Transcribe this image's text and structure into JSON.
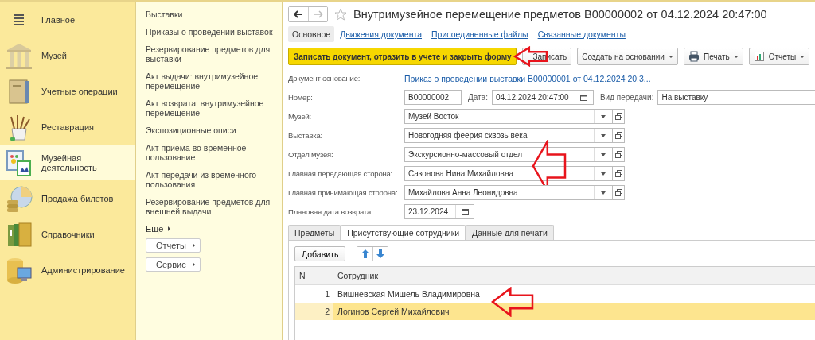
{
  "sections": [
    {
      "label": "Главное",
      "selected": false
    },
    {
      "label": "Музей",
      "selected": false
    },
    {
      "label": "Учетные операции",
      "selected": false
    },
    {
      "label": "Реставрация",
      "selected": false
    },
    {
      "label": "Музейная деятельность",
      "selected": true
    },
    {
      "label": "Продажа билетов",
      "selected": false
    },
    {
      "label": "Справочники",
      "selected": false
    },
    {
      "label": "Администрирование",
      "selected": false
    }
  ],
  "section_menu": {
    "items": [
      "Выставки",
      "Приказы о проведении выставок",
      "Резервирование предметов для выставки",
      "Акт выдачи: внутримузейное перемещение",
      "Акт возврата: внутримузейное перемещение",
      "Экспозиционные описи",
      "Акт приема во временное пользование",
      "Акт передачи из временного пользования",
      "Резервирование предметов для внешней выдачи"
    ],
    "more": "Еще",
    "buttons": [
      "Отчеты",
      "Сервис"
    ]
  },
  "document": {
    "title": "Внутримузейное перемещение предметов В00000002 от 04.12.2024 20:47:00",
    "tabs": [
      {
        "label": "Основное",
        "selected": true
      },
      {
        "label": "Движения документа",
        "selected": false
      },
      {
        "label": "Присоединенные файлы",
        "selected": false
      },
      {
        "label": "Связанные документы",
        "selected": false
      }
    ],
    "toolbar": [
      {
        "kind": "primary",
        "label": "Записать документ, отразить в учете и закрыть форму",
        "marked": true
      },
      {
        "kind": "plain",
        "label": "Записать",
        "marked": false
      },
      {
        "kind": "menu",
        "label": "Создать на основании",
        "marked": false
      },
      {
        "kind": "print",
        "label": "Печать",
        "marked": false
      },
      {
        "kind": "report",
        "label": "Отчеты",
        "marked": false
      }
    ],
    "basis": {
      "label": "Документ основание:",
      "link": "Приказ о проведении выставки В00000001 от 04.12.2024 20:3..."
    },
    "number": {
      "label": "Номер:",
      "value": "В00000002"
    },
    "date": {
      "label": "Дата:",
      "value": "04.12.2024 20:47:00"
    },
    "transfer_type": {
      "label": "Вид передачи:",
      "value": "На выставку"
    },
    "fields": [
      {
        "label": "Музей:",
        "value": "Музей Восток",
        "marked": false
      },
      {
        "label": "Выставка:",
        "value": "Новогодняя феерия сквозь века",
        "marked": false
      },
      {
        "label": "Отдел музея:",
        "value": "Экскурсионно-массовый отдел",
        "marked": false
      },
      {
        "label": "Главная передающая сторона:",
        "value": "Сазонова Нина Михайловна",
        "marked": true
      },
      {
        "label": "Главная принимающая сторона:",
        "value": "Михайлова Анна Леонидовна",
        "marked": false
      }
    ],
    "return_date": {
      "label": "Плановая дата возврата:",
      "value": "23.12.2024"
    },
    "subtabs": [
      {
        "label": "Предметы",
        "selected": false
      },
      {
        "label": "Присутствующие сотрудники",
        "selected": true
      },
      {
        "label": "Данные для печати",
        "selected": false
      }
    ],
    "add_button": "Добавить",
    "table": {
      "columns": [
        "N",
        "Сотрудник"
      ],
      "rows": [
        {
          "n": "1",
          "employee": "Вишневская Мишель Владимировна",
          "selected": false,
          "marked": true
        },
        {
          "n": "2",
          "employee": "Логинов Сергей Михайлович",
          "selected": true,
          "marked": false
        }
      ]
    }
  }
}
